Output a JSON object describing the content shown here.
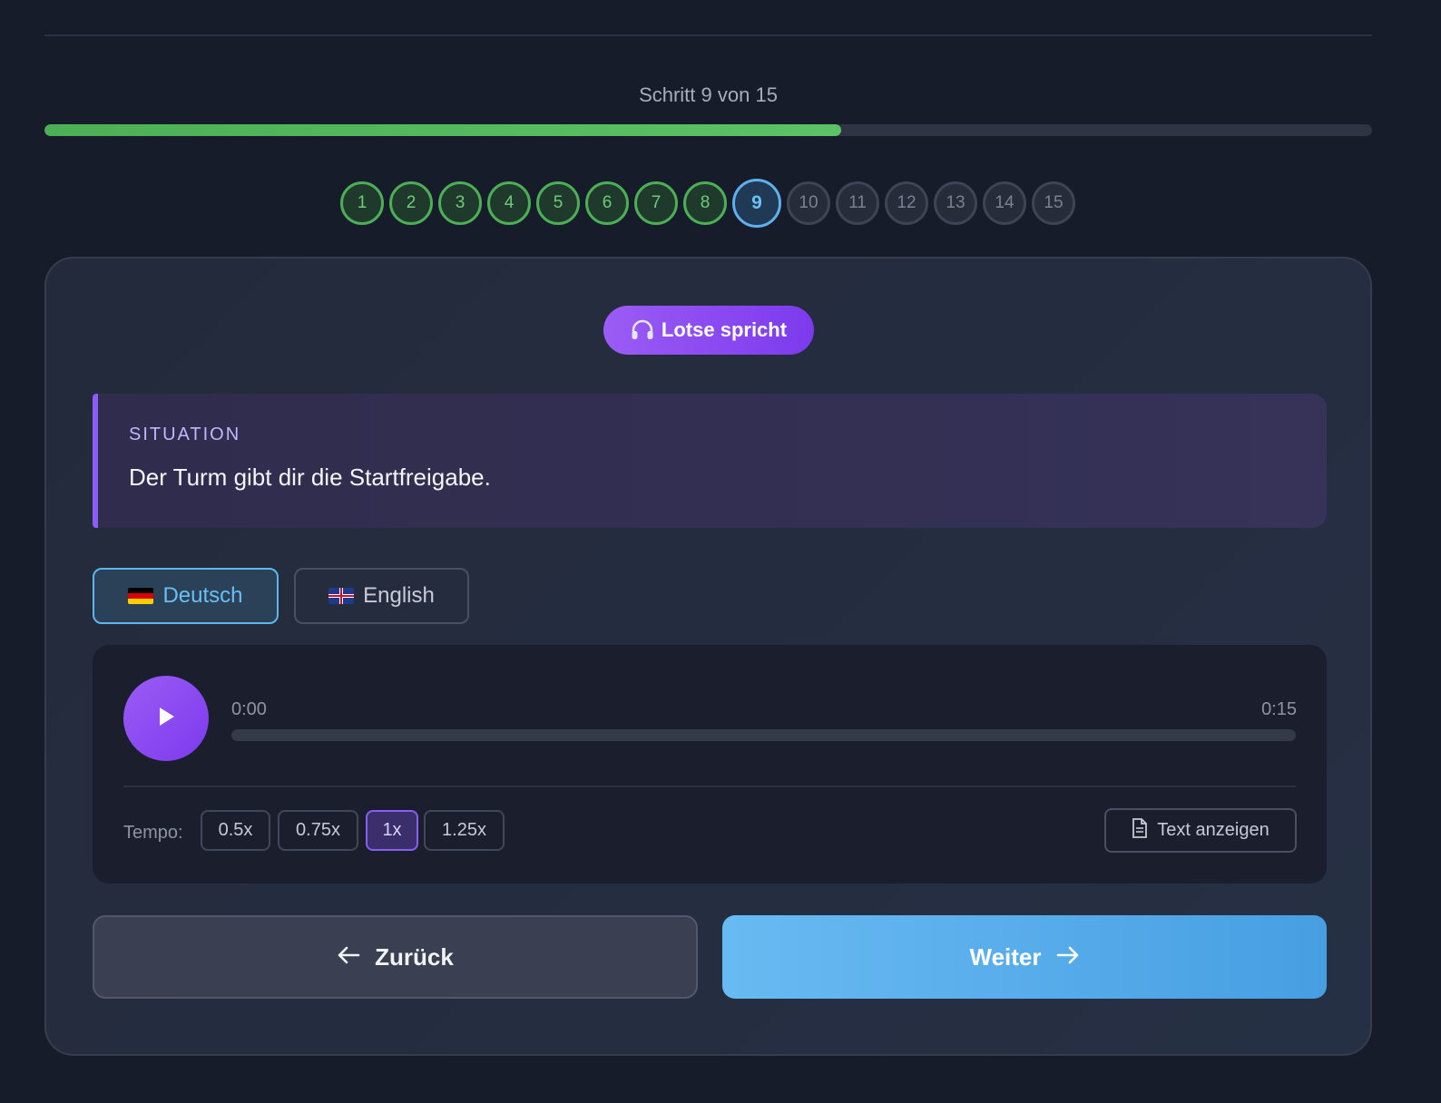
{
  "progress": {
    "step_text": "Schritt 9 von 15",
    "fraction": 0.6,
    "accent": "#4caf55"
  },
  "steps": {
    "current": 9,
    "items": [
      "1",
      "2",
      "3",
      "4",
      "5",
      "6",
      "7",
      "8",
      "9",
      "10",
      "11",
      "12",
      "13",
      "14",
      "15"
    ]
  },
  "badge": {
    "icon": "headphones-icon",
    "label": "Lotse spricht"
  },
  "situation": {
    "label": "SITUATION",
    "text": "Der Turm gibt dir die Startfreigabe."
  },
  "languages": {
    "selected": "de",
    "de_label": "Deutsch",
    "en_label": "English"
  },
  "player": {
    "time_current": "0:00",
    "time_total": "0:15",
    "tempo_label": "Tempo:",
    "speeds": [
      "0.5x",
      "0.75x",
      "1x",
      "1.25x"
    ],
    "active_speed": "1x",
    "text_button": "Text anzeigen"
  },
  "nav": {
    "back_label": "Zurück",
    "next_label": "Weiter"
  }
}
